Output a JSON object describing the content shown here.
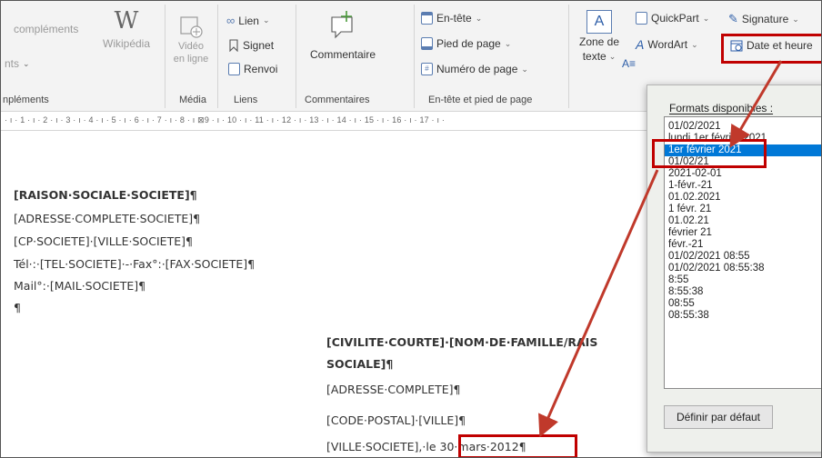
{
  "ribbon": {
    "col1": {
      "complements": "compléments",
      "item2": "nts",
      "label": "npléments"
    },
    "wikipedia": "Wikipédia",
    "media": {
      "line1": "Vidéo",
      "line2": "en ligne",
      "label": "Média"
    },
    "liens": {
      "lien": "Lien",
      "signet": "Signet",
      "renvoi": "Renvoi",
      "label": "Liens"
    },
    "commentaires": {
      "commentaire": "Commentaire",
      "label": "Commentaires"
    },
    "entete": {
      "entete": "En-tête",
      "pied": "Pied de page",
      "numero": "Numéro de page",
      "label": "En-tête et pied de page"
    },
    "texte": {
      "zone_line1": "Zone de",
      "zone_line2": "texte",
      "quickpart": "QuickPart",
      "signature": "Signature",
      "wordart": "WordArt",
      "date_heure": "Date et heure"
    }
  },
  "ruler": {
    "text": "· ı · 1 · ı · 2 · ı · 3 · ı · 4 · ı · 5 · ı · 6 · ı · 7 · ı · 8 · ı ⊠9 · ı · 10 · ı · 11 · ı · 12 · ı · 13 · ı · 14 · ı · 15 · ı · 16 · ı · 17 · ı ·"
  },
  "document": {
    "lines_left": [
      "[RAISON·SOCIALE·SOCIETE]¶",
      "[ADRESSE·COMPLETE·SOCIETE]¶",
      "[CP·SOCIETE]·[VILLE·SOCIETE]¶",
      "Tél·:·[TEL·SOCIETE]·-·Fax°:·[FAX·SOCIETE]¶",
      "Mail°:·[MAIL·SOCIETE]¶",
      "¶"
    ],
    "lines_right": [
      "[CIVILITE·COURTE]·[NOM·DE·FAMILLE/RAIS",
      "SOCIALE]¶",
      "[ADRESSE·COMPLETE]¶",
      "[CODE·POSTAL]·[VILLE]¶"
    ],
    "last_line_prefix": "[VILLE·SOCIETE],·le",
    "date_field": "30·mars·2012¶"
  },
  "dialog": {
    "title": "Formats disponibles :",
    "formats": [
      "01/02/2021",
      "lundi 1er février 2021",
      "1er février 2021",
      "01/02/21",
      "2021-02-01",
      "1-févr.-21",
      "01.02.2021",
      "1 févr. 21",
      "01.02.21",
      "février 21",
      "févr.-21",
      "01/02/2021 08:55",
      "01/02/2021 08:55:38",
      "8:55",
      "8:55:38",
      "08:55",
      "08:55:38"
    ],
    "selected_index": 2,
    "default_button": "Définir par défaut"
  },
  "colors": {
    "highlight": "#c00000",
    "selection": "#0078d7",
    "arrow": "#c0392b"
  }
}
